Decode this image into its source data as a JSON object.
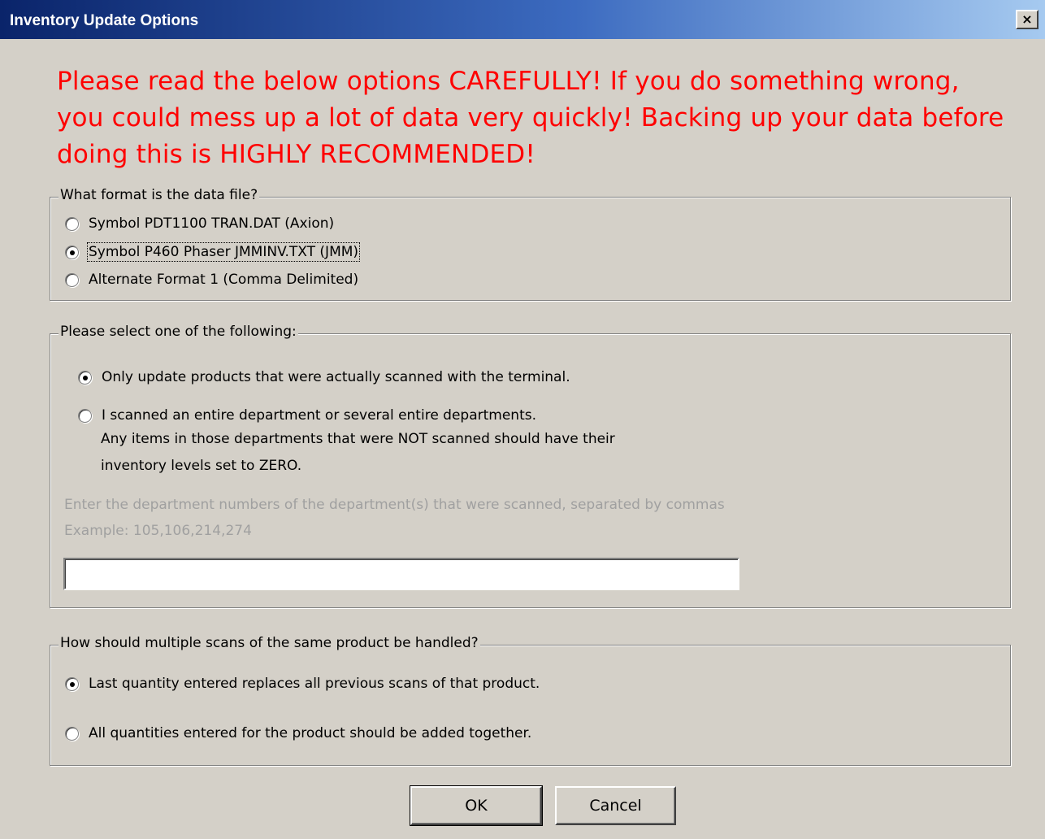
{
  "window": {
    "title": "Inventory Update Options",
    "close_label": "×"
  },
  "warning": {
    "line1": "Please read the below options CAREFULLY!  If you do something wrong,",
    "line2": "you could mess up a lot of data very quickly!  Backing up your data before",
    "line3": "doing this is HIGHLY RECOMMENDED!"
  },
  "format_group": {
    "legend": "What format is the data file?",
    "options": [
      {
        "label": "Symbol PDT1100 TRAN.DAT (Axion)",
        "checked": false
      },
      {
        "label": "Symbol P460 Phaser   JMMINV.TXT (JMM)",
        "checked": true
      },
      {
        "label": "Alternate Format 1 (Comma Delimited)",
        "checked": false
      }
    ]
  },
  "update_group": {
    "legend": "Please select one of the following:",
    "option1": "Only update products that were actually scanned with the terminal.",
    "option2_line1": "I scanned an entire department or several entire departments.",
    "option2_line2": "Any items in those departments that were NOT scanned should have their",
    "option2_line3": "inventory levels set to ZERO.",
    "dept_prompt": "Enter the department numbers of the department(s) that were scanned, separated by commas",
    "dept_example": "Example: 105,106,214,274",
    "dept_value": ""
  },
  "scans_group": {
    "legend": "How should multiple scans of the same product be handled?",
    "option1": "Last quantity entered replaces all previous scans of that product.",
    "option2": "All quantities entered for the product should be added together."
  },
  "buttons": {
    "ok": "OK",
    "cancel": "Cancel"
  }
}
